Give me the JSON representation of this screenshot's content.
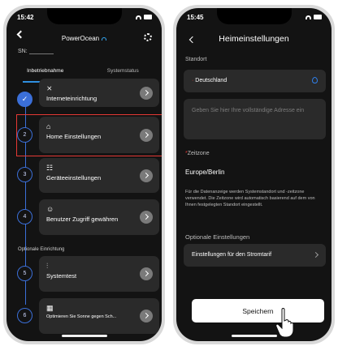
{
  "phone1": {
    "status_time": "15:42",
    "header_title": "PowerOcean",
    "sn_label": "SN:",
    "tabs": [
      "Inbetriebnahme",
      "Systemstatus"
    ],
    "steps": [
      {
        "number": "",
        "label": "Interneteinrichtung",
        "icon": "wifi-icon"
      },
      {
        "number": "2",
        "label": "Home Einstellungen",
        "icon": "home-icon"
      },
      {
        "number": "3",
        "label": "Geräteeinstellungen",
        "icon": "grid-icon"
      },
      {
        "number": "4",
        "label": "Benutzer Zugriff gewähren",
        "icon": "user-icon"
      },
      {
        "number": "5",
        "label": "Systemtest",
        "icon": "sliders-icon"
      },
      {
        "number": "6",
        "label": "Optimieren Sie Sonne gegen Sch...",
        "icon": "solar-panel-icon"
      }
    ],
    "section_optional": "Optionale Einrichtung"
  },
  "phone2": {
    "status_time": "15:45",
    "header_title": "Heimeinstellungen",
    "standort_label": "Standort",
    "country_value": "Deutschland",
    "address_placeholder": "Geben Sie hier Ihre vollständige Adresse ein",
    "timezone_label": "Zeitzone",
    "timezone_value": "Europe/Berlin",
    "info_text": "Für die Datenanzeige werden Systemstandort und -zeitzone verwendet. Die Zeitzone wird automatisch basierend auf dem von Ihnen festgelegten Standort eingestellt.",
    "optional_label": "Optionale Einstellungen",
    "tariff_label": "Einstellungen für den Stromtarif",
    "save_label": "Speichern"
  },
  "colors": {
    "accent": "#3b6fd8",
    "highlight": "#e53935",
    "background": "#131313",
    "card": "#2a2a2a"
  }
}
